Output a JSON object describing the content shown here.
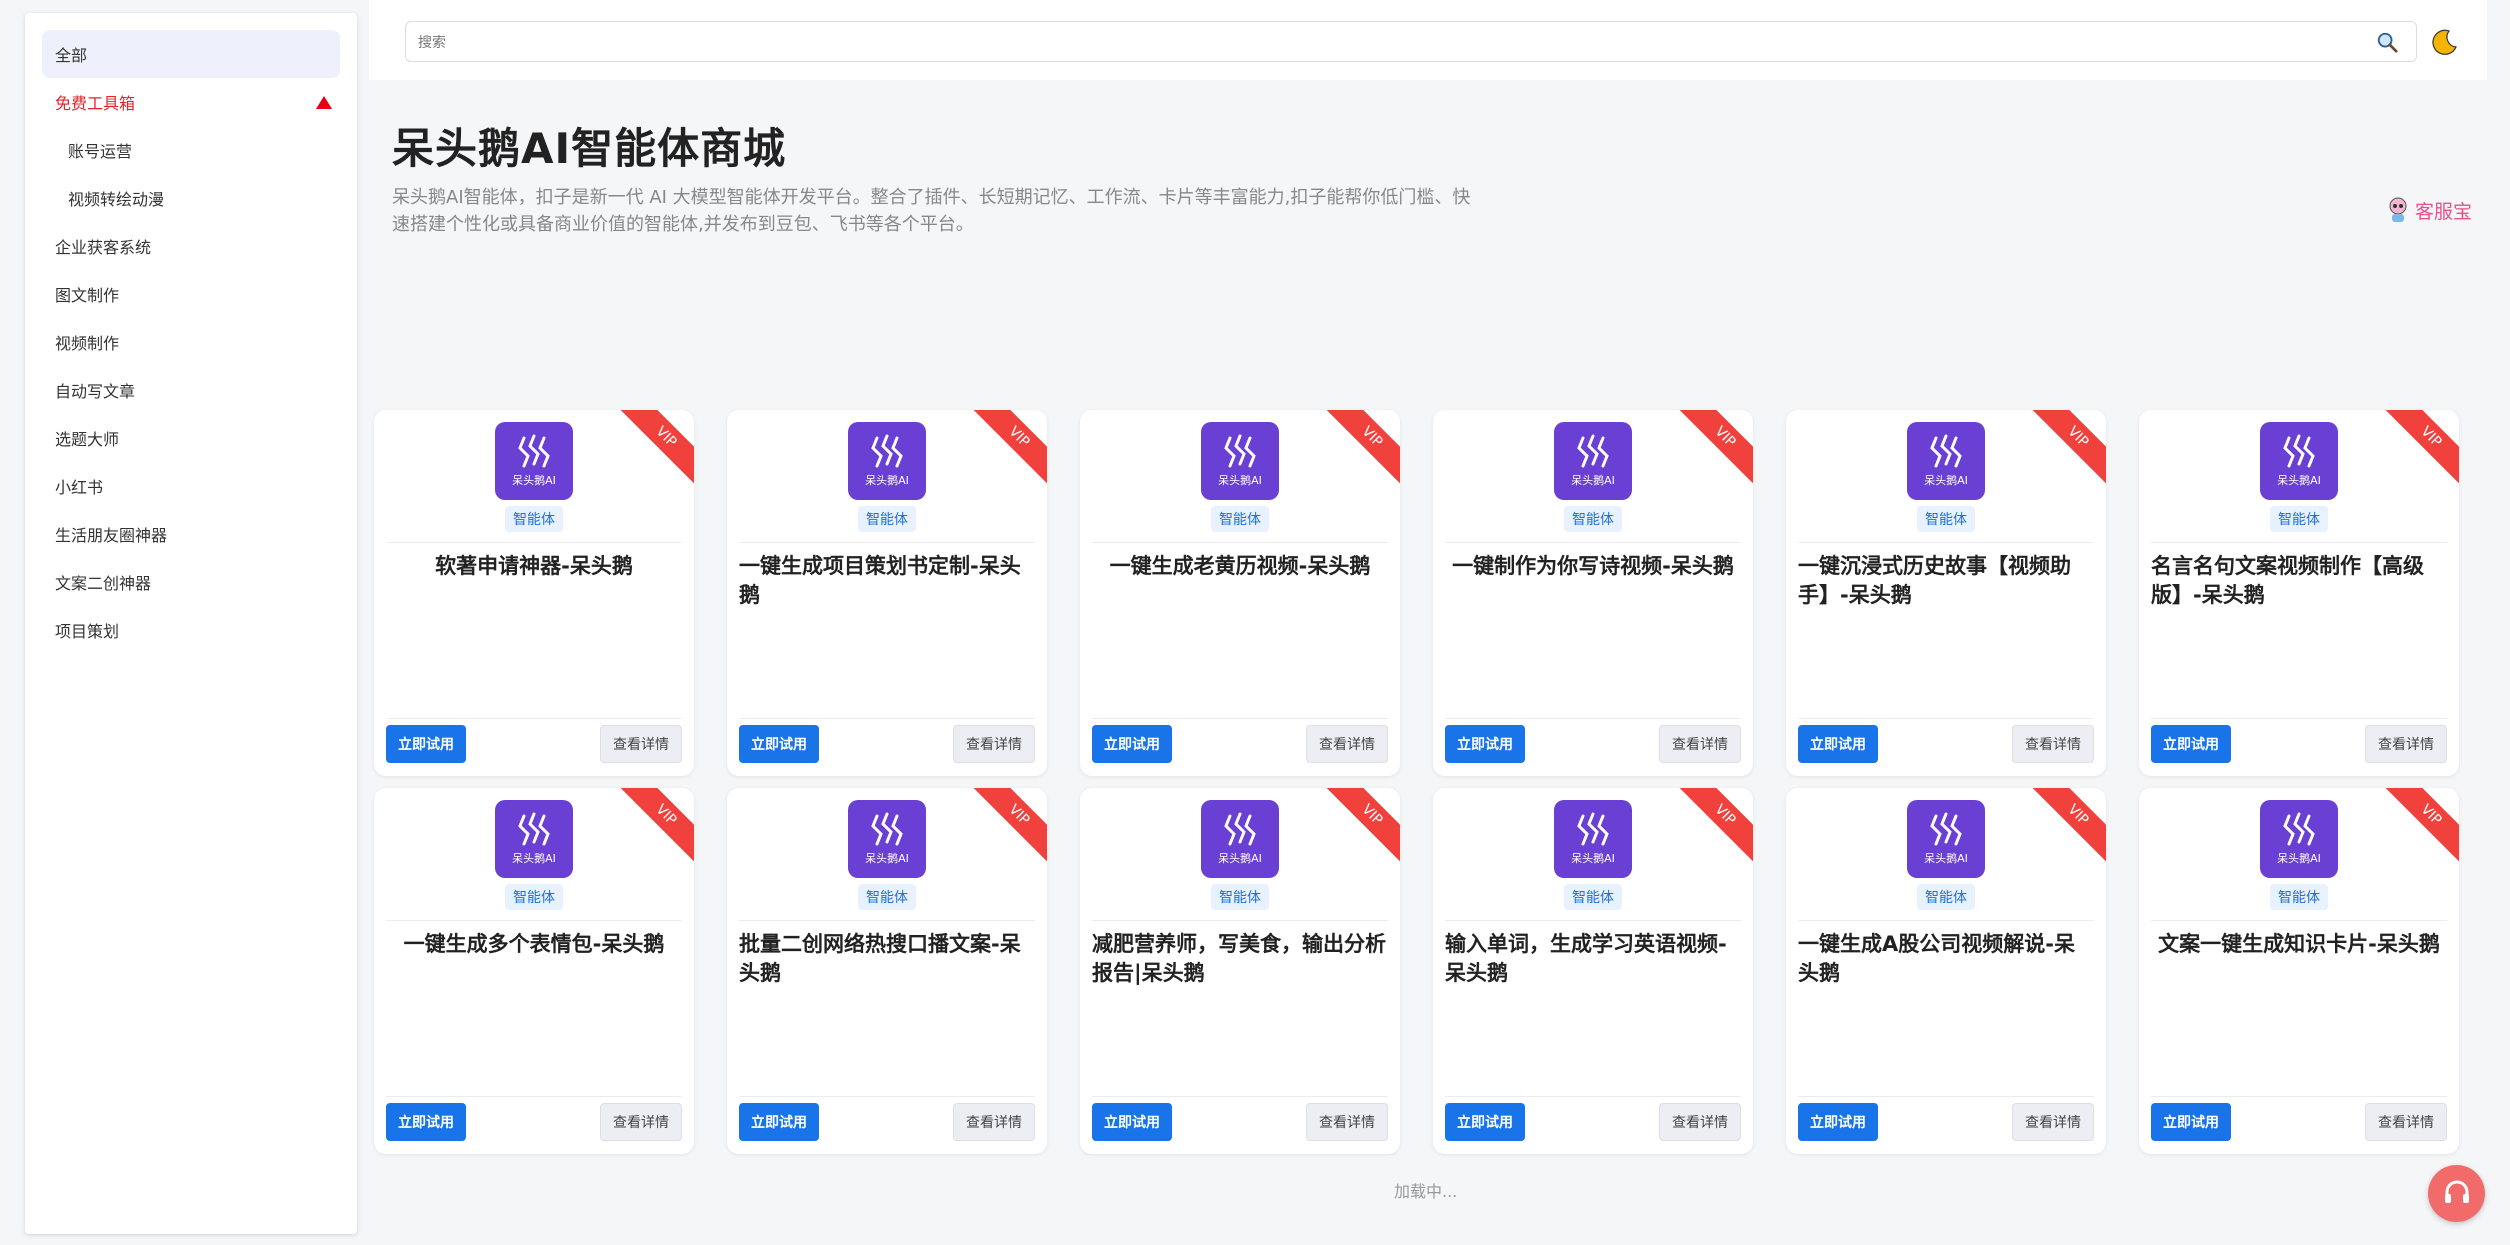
{
  "sidebar": {
    "items": [
      {
        "label": "全部",
        "state": "active"
      },
      {
        "label": "免费工具箱",
        "state": "open"
      },
      {
        "label": "账号运营",
        "state": "sub"
      },
      {
        "label": "视频转绘动漫",
        "state": "sub"
      },
      {
        "label": "企业获客系统",
        "state": ""
      },
      {
        "label": "图文制作",
        "state": ""
      },
      {
        "label": "视频制作",
        "state": ""
      },
      {
        "label": "自动写文章",
        "state": ""
      },
      {
        "label": "选题大师",
        "state": ""
      },
      {
        "label": "小红书",
        "state": ""
      },
      {
        "label": "生活朋友圈神器",
        "state": ""
      },
      {
        "label": "文案二创神器",
        "state": ""
      },
      {
        "label": "项目策划",
        "state": ""
      }
    ]
  },
  "search": {
    "placeholder": "搜索"
  },
  "header": {
    "title": "呆头鹅AI智能体商城",
    "description": "呆头鹅AI智能体，扣子是新一代 AI 大模型智能体开发平台。整合了插件、长短期记忆、工作流、卡片等丰富能力,扣子能帮你低门槛、快速搭建个性化或具备商业价值的智能体,并发布到豆包、飞书等各个平台。"
  },
  "service": {
    "label": "客服宝"
  },
  "card_common": {
    "logo_text": "呆头鹅AI",
    "tag": "智能体",
    "vip": "VIP",
    "try_label": "立即试用",
    "detail_label": "查看详情"
  },
  "cards": [
    {
      "title": "软著申请神器-呆头鹅",
      "centered": true
    },
    {
      "title": "一键生成项目策划书定制-呆头鹅",
      "centered": false
    },
    {
      "title": "一键生成老黄历视频-呆头鹅",
      "centered": true
    },
    {
      "title": "一键制作为你写诗视频-呆头鹅",
      "centered": true
    },
    {
      "title": "一键沉浸式历史故事【视频助手】-呆头鹅",
      "centered": false
    },
    {
      "title": "名言名句文案视频制作【高级版】-呆头鹅",
      "centered": false
    },
    {
      "title": "一键生成多个表情包-呆头鹅",
      "centered": true
    },
    {
      "title": "批量二创网络热搜口播文案-呆头鹅",
      "centered": false
    },
    {
      "title": "减肥营养师，写美食，输出分析报告|呆头鹅",
      "centered": false
    },
    {
      "title": "输入单词，生成学习英语视频-呆头鹅",
      "centered": false
    },
    {
      "title": "一键生成A股公司视频解说-呆头鹅",
      "centered": false
    },
    {
      "title": "文案一键生成知识卡片-呆头鹅",
      "centered": true
    }
  ],
  "footer": {
    "loading": "加载中..."
  },
  "colors": {
    "primary": "#1874e8",
    "vip": "#f0413d",
    "logo_bg": "#6a3fd4",
    "accent_red": "#e0242d"
  }
}
